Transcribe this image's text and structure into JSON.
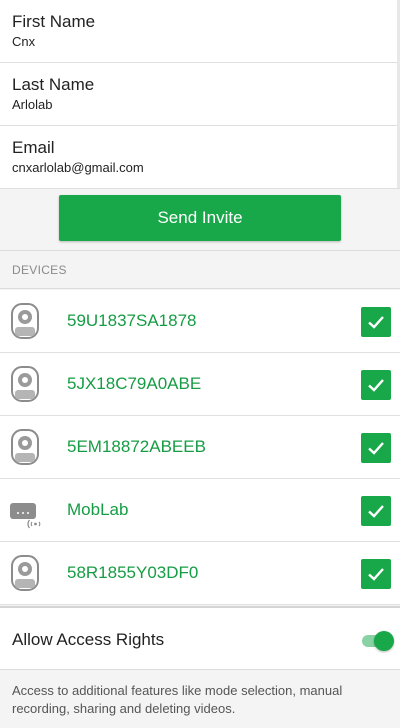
{
  "form": {
    "first_name": {
      "label": "First Name",
      "value": "Cnx"
    },
    "last_name": {
      "label": "Last Name",
      "value": "Arlolab"
    },
    "email": {
      "label": "Email",
      "value": "cnxarlolab@gmail.com"
    }
  },
  "send_invite_label": "Send Invite",
  "devices_header": "DEVICES",
  "devices": [
    {
      "name": "59U1837SA1878",
      "icon": "camera-icon",
      "checked": true
    },
    {
      "name": "5JX18C79A0ABE",
      "icon": "camera-icon",
      "checked": true
    },
    {
      "name": "5EM18872ABEEB",
      "icon": "camera-icon",
      "checked": true
    },
    {
      "name": "MobLab",
      "icon": "base-station-icon",
      "checked": true
    },
    {
      "name": "58R1855Y03DF0",
      "icon": "camera-icon",
      "checked": true
    }
  ],
  "access": {
    "label": "Allow Access Rights",
    "enabled": true,
    "description": "Access to additional features like mode selection, manual recording, sharing and deleting videos."
  },
  "colors": {
    "accent": "#18a84a",
    "device_text": "#169c44",
    "toggle_track": "#88d2a3",
    "background": "#f4f4f4"
  }
}
